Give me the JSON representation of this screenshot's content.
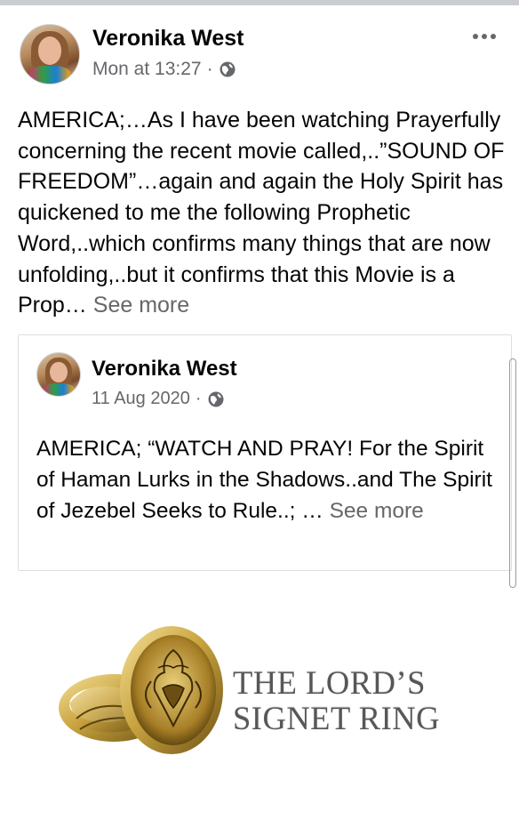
{
  "post": {
    "author": "Veronika West",
    "time": "Mon at 13:27",
    "privacy_icon": "globe-icon",
    "meta_separator": "·",
    "text": "AMERICA;…As I have been watching Prayerfully concerning the recent movie called,..”SOUND OF FREEDOM”…again and again the Holy Spirit has quickened to me the following Prophetic Word,..which confirms many things that are now unfolding,..but it confirms that this Movie is a Prop… ",
    "see_more": "See more",
    "options_icon": "more-options-icon"
  },
  "shared_post": {
    "author": "Veronika West",
    "time": "11 Aug 2020",
    "meta_separator": "·",
    "privacy_icon": "globe-icon",
    "text": "AMERICA; “WATCH AND PRAY! For the Spirit of Haman Lurks in the Shadows..and The Spirit of Jezebel Seeks to Rule..; … ",
    "see_more": "See more"
  },
  "media": {
    "image": "signet-ring-image",
    "caption_line1": "THE LORD’S",
    "caption_line2": "SIGNET RING"
  },
  "colors": {
    "text": "#050505",
    "secondary": "#65676b",
    "divider": "#dcdfe3",
    "gold": "#c9a43f"
  }
}
